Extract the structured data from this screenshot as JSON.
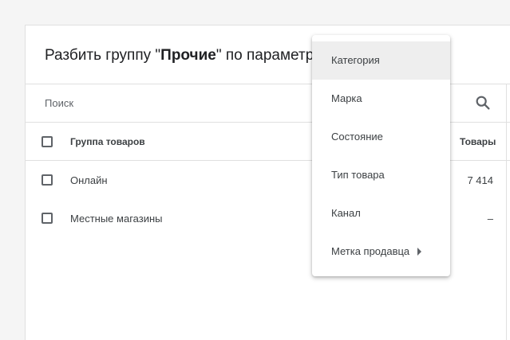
{
  "dialog": {
    "title_prefix": "Разбить группу \"",
    "title_group": "Прочие",
    "title_suffix": "\" по параметру:"
  },
  "search": {
    "label": "Поиск",
    "icon": "search-icon"
  },
  "table": {
    "headers": {
      "group": "Группа товаров",
      "products": "Товары"
    },
    "rows": [
      {
        "name": "Онлайн",
        "products": "7 414"
      },
      {
        "name": "Местные магазины",
        "products": "–"
      }
    ]
  },
  "menu": {
    "items": [
      {
        "label": "Категория",
        "highlighted": true
      },
      {
        "label": "Марка"
      },
      {
        "label": "Состояние"
      },
      {
        "label": "Тип товара"
      },
      {
        "label": "Канал"
      },
      {
        "label": "Метка продавца",
        "has_submenu": true
      }
    ]
  },
  "colors": {
    "highlight": "#eeeeee",
    "divider": "#e0e0e0",
    "text": "#3c4043"
  }
}
